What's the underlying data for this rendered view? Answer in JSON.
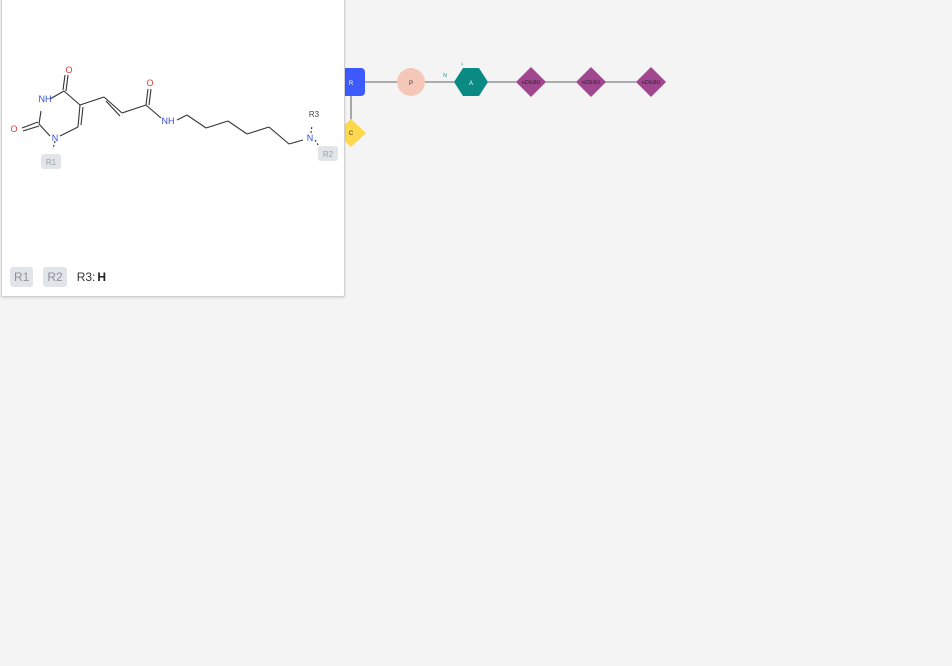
{
  "sequence": {
    "nodes": {
      "r": "R",
      "p": "P",
      "a": "A",
      "c": "C",
      "m1": "nC6n5U",
      "m2": "nC6n5U",
      "m3": "nC6n5U"
    },
    "annotations": {
      "n_label": "N",
      "one_label": "1"
    },
    "colors": {
      "r": "#3d5afe",
      "p": "#f4c7b8",
      "a": "#0b8a84",
      "c": "#ffd84d",
      "m": "#a1478f"
    }
  },
  "structure": {
    "atoms": {
      "o_top": "O",
      "nh_ring": "NH",
      "o_left": "O",
      "n_ring": "N",
      "o_amide": "O",
      "nh_amide": "NH",
      "n_term": "N",
      "r3_label": "R3"
    },
    "attachment_labels": {
      "r1": "R1",
      "r2": "R2"
    }
  },
  "footer": {
    "r1_chip": "R1",
    "r2_chip": "R2",
    "r3_prefix": "R3:",
    "r3_value": "H"
  },
  "colors": {
    "oxygen": "#e53935",
    "nitrogen": "#2f4fd6",
    "bond": "#333333"
  }
}
